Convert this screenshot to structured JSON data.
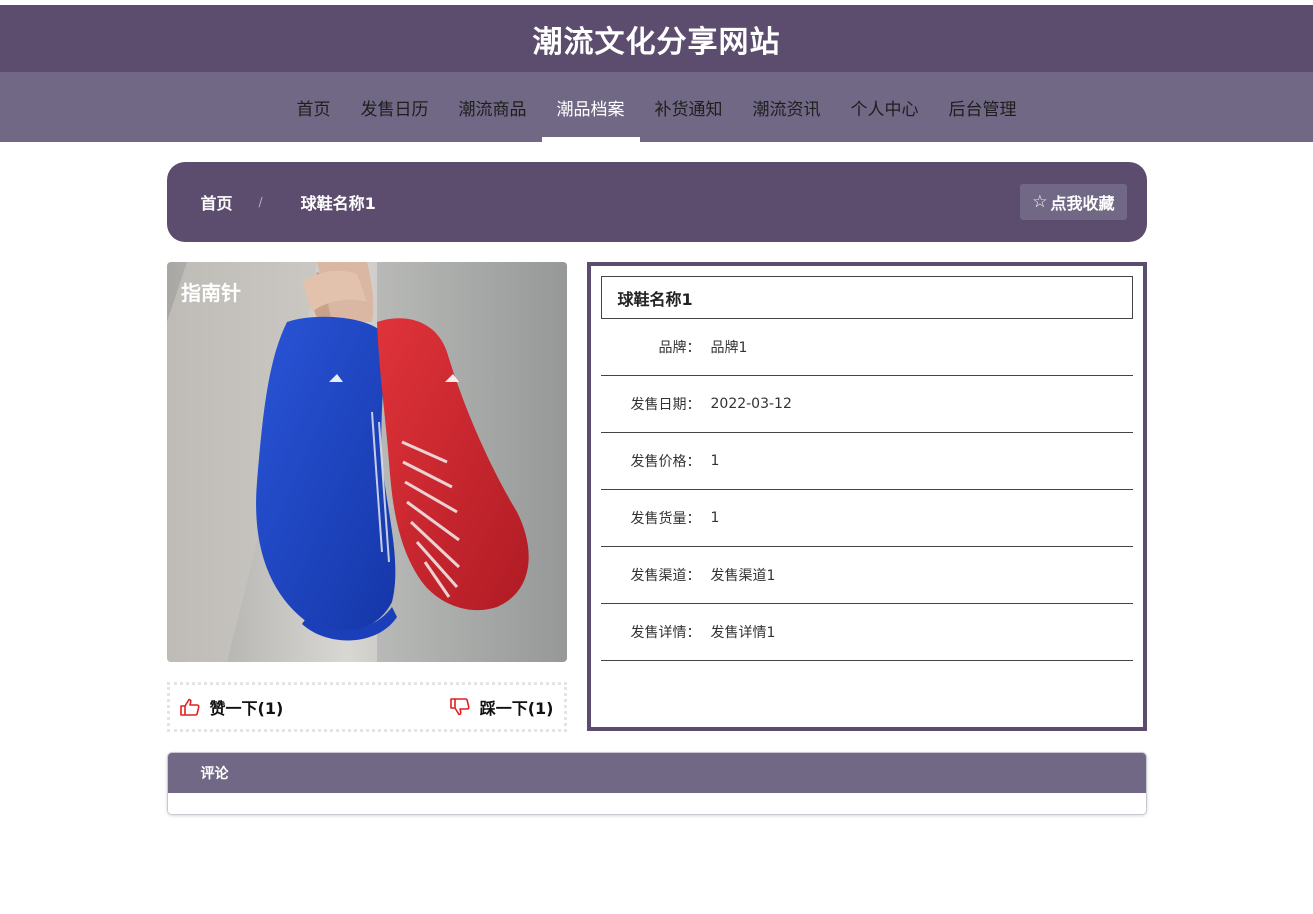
{
  "site": {
    "title": "潮流文化分享网站"
  },
  "nav": {
    "items": [
      {
        "label": "首页",
        "name": "nav-home"
      },
      {
        "label": "发售日历",
        "name": "nav-release-calendar"
      },
      {
        "label": "潮流商品",
        "name": "nav-trend-products"
      },
      {
        "label": "潮品档案",
        "name": "nav-trend-archive",
        "active": true
      },
      {
        "label": "补货通知",
        "name": "nav-restock-notice"
      },
      {
        "label": "潮流资讯",
        "name": "nav-trend-news"
      },
      {
        "label": "个人中心",
        "name": "nav-personal-center"
      },
      {
        "label": "后台管理",
        "name": "nav-admin"
      }
    ]
  },
  "breadcrumb": {
    "home": "首页",
    "separator": "/",
    "current": "球鞋名称1"
  },
  "favorite": {
    "icon": "star-icon",
    "label": "点我收藏"
  },
  "product": {
    "name": "球鞋名称1",
    "fields": [
      {
        "label": "品牌：",
        "value": "品牌1"
      },
      {
        "label": "发售日期：",
        "value": "2022-03-12"
      },
      {
        "label": "发售价格：",
        "value": "1"
      },
      {
        "label": "发售货量：",
        "value": "1"
      },
      {
        "label": "发售渠道：",
        "value": "发售渠道1"
      },
      {
        "label": "发售详情：",
        "value": "发售详情1"
      }
    ],
    "image_watermark": "指南针"
  },
  "votes": {
    "like": {
      "icon": "thumbs-up-icon",
      "label": "赞一下(1)"
    },
    "dislike": {
      "icon": "thumbs-down-icon",
      "label": "踩一下(1)"
    }
  },
  "comments": {
    "title": "评论"
  },
  "colors": {
    "primary": "#5c4d6e",
    "secondary": "#706884",
    "vote_icon": "#e02020"
  }
}
